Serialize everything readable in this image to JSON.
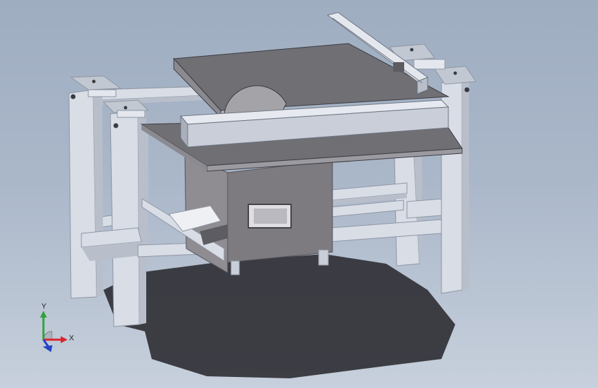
{
  "viewport": {
    "background_top": "#9fadc1",
    "background_bottom": "#c7d0dc"
  },
  "model": {
    "part_colors": {
      "frame": "#d8dde6",
      "frame_shade": "#b8bfcb",
      "table_top": "#6f6f74",
      "table_edge": "#8a8a90",
      "cabinet": "#7d7a80",
      "fence": "#c9ced8",
      "blade": "#9a9a9e",
      "shadow": "#2a2a2e"
    }
  },
  "triad": {
    "y_label": "Y",
    "x_label": "X",
    "y_color": "#2fa33c",
    "x_color": "#d8262c",
    "z_color": "#2343c8"
  }
}
